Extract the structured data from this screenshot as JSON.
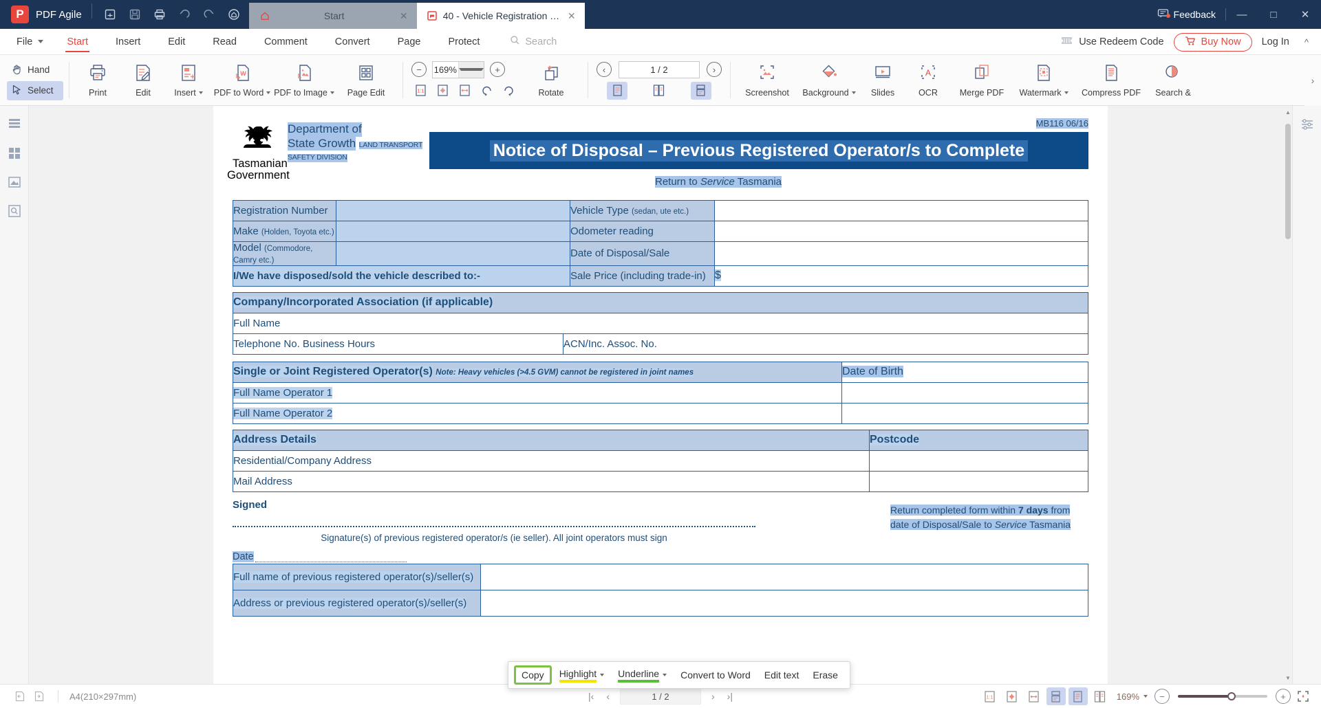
{
  "app": {
    "brand": "PDF Agile",
    "brand_initial": "P",
    "titlebar_icons": [
      "open-file-icon",
      "save-icon",
      "print-icon",
      "undo-icon",
      "redo-icon",
      "home-circle-icon"
    ],
    "feedback_label": "Feedback",
    "window_controls": {
      "minimize": "—",
      "maximize": "□",
      "close": "✕"
    }
  },
  "tabs": [
    {
      "label": "Start",
      "icon": "home-icon",
      "active": false,
      "close": "✕"
    },
    {
      "label": "40 - Vehicle Registration Tra...",
      "icon": "pdf-file-icon",
      "active": true,
      "close": "✕"
    }
  ],
  "menubar": {
    "file_label": "File",
    "items": [
      "Start",
      "Insert",
      "Edit",
      "Read",
      "Comment",
      "Convert",
      "Page",
      "Protect"
    ],
    "active_item": "Start",
    "search_placeholder": "Search",
    "redeem_label": "Use Redeem Code",
    "buy_label": "Buy Now",
    "login_label": "Log In",
    "collapse_icon": "chevron-up-icon"
  },
  "ribbon": {
    "hand_label": "Hand",
    "select_label": "Select",
    "selected_tool": "Select",
    "buttons": [
      {
        "label": "Print",
        "icon": "printer-icon",
        "dropdown": false
      },
      {
        "label": "Edit",
        "icon": "edit-document-icon",
        "dropdown": false
      },
      {
        "label": "Insert",
        "icon": "insert-page-icon",
        "dropdown": true
      },
      {
        "label": "PDF to Word",
        "icon": "pdf-to-word-icon",
        "dropdown": true
      },
      {
        "label": "PDF to Image",
        "icon": "pdf-to-image-icon",
        "dropdown": true
      },
      {
        "label": "Page Edit",
        "icon": "page-edit-icon",
        "dropdown": false
      }
    ],
    "zoom": {
      "value": "169%",
      "minus": "−",
      "plus": "+"
    },
    "rotate_label": "Rotate",
    "page_indicator": "1 / 2",
    "right_buttons": [
      {
        "label": "Screenshot",
        "icon": "screenshot-icon",
        "dropdown": false
      },
      {
        "label": "Background",
        "icon": "background-icon",
        "dropdown": true
      },
      {
        "label": "Slides",
        "icon": "slides-icon",
        "dropdown": false
      },
      {
        "label": "OCR",
        "icon": "ocr-icon",
        "dropdown": false
      },
      {
        "label": "Merge PDF",
        "icon": "merge-pdf-icon",
        "dropdown": false
      },
      {
        "label": "Watermark",
        "icon": "watermark-icon",
        "dropdown": true
      },
      {
        "label": "Compress PDF",
        "icon": "compress-pdf-icon",
        "dropdown": false
      },
      {
        "label": "Search &",
        "icon": "search-replace-icon",
        "dropdown": false
      }
    ]
  },
  "document": {
    "doc_code": "MB116 06/16",
    "crest_caption_line1": "Tasmanian",
    "crest_caption_line2": "Government",
    "dept_line1": "Department of",
    "dept_line2": "State Growth",
    "dept_sub1": "LAND TRANSPORT",
    "dept_sub2": "SAFETY DIVISION",
    "title": "Notice of Disposal – Previous Registered Operator/s to Complete",
    "return_to": "Return to Service Tasmania",
    "vehicle_rows": [
      {
        "left_label": "Registration Number",
        "left_hint": "",
        "right_label": "Vehicle Type",
        "right_hint": "(sedan, ute etc.)"
      },
      {
        "left_label": "Make",
        "left_hint": "(Holden, Toyota etc.)",
        "right_label": "Odometer reading",
        "right_hint": ""
      },
      {
        "left_label": "Model",
        "left_hint": "(Commodore, Camry etc.)",
        "right_label": "Date of Disposal/Sale",
        "right_hint": ""
      }
    ],
    "disposed_text": "I/We have disposed/sold the vehicle described to:-",
    "sale_price_label": "Sale Price (including trade-in)",
    "dollar_sign": "$",
    "company_section": "Company/Incorporated Association (if applicable)",
    "full_name_label": "Full Name",
    "telephone_label": "Telephone No. Business Hours",
    "acn_label": "ACN/Inc. Assoc. No.",
    "operators_section": "Single or Joint Registered Operator(s)",
    "operators_note": "Note: Heavy vehicles (>4.5 GVM) cannot be registered in joint names",
    "dob_label": "Date of Birth",
    "operator1_label": "Full Name Operator 1",
    "operator2_label": "Full Name Operator 2",
    "address_section": "Address Details",
    "postcode_label": "Postcode",
    "residential_label": "Residential/Company Address",
    "mail_label": "Mail Address",
    "signed_label": "Signed",
    "signature_caption": "Signature(s) of previous registered operator/s (ie seller). All joint operators must sign",
    "date_label": "Date",
    "return_note_line1_a": "Return completed form within ",
    "return_note_line1_b": "7 days",
    "return_note_line1_c": " from",
    "return_note_line2": "date of Disposal/Sale to Service Tasmania",
    "seller_name_label": "Full name of previous registered operator(s)/seller(s)",
    "seller_address_label": "Address or previous registered operator(s)/seller(s)"
  },
  "annotation_toolbar": {
    "items": [
      {
        "label": "Copy",
        "style": "boxed"
      },
      {
        "label": "Highlight",
        "style": "underline-yellow",
        "dropdown": true
      },
      {
        "label": "Underline",
        "style": "underline-green",
        "dropdown": true
      },
      {
        "label": "Convert to Word",
        "style": "plain"
      },
      {
        "label": "Edit text",
        "style": "plain"
      },
      {
        "label": "Erase",
        "style": "plain"
      }
    ]
  },
  "statusbar": {
    "page_size": "A4(210×297mm)",
    "page_indicator": "1 / 2",
    "zoom": "169%",
    "first_page": "|‹",
    "prev_page": "‹",
    "next_page": "›",
    "last_page": "›|",
    "minus": "−",
    "plus": "+"
  },
  "colors": {
    "titlebar": "#1c3455",
    "accent_red": "#e8453c",
    "doc_blue": "#1f4e79",
    "header_blue": "#0d4a88",
    "selection": "#a8c4e8",
    "green_box": "#7dc242"
  }
}
